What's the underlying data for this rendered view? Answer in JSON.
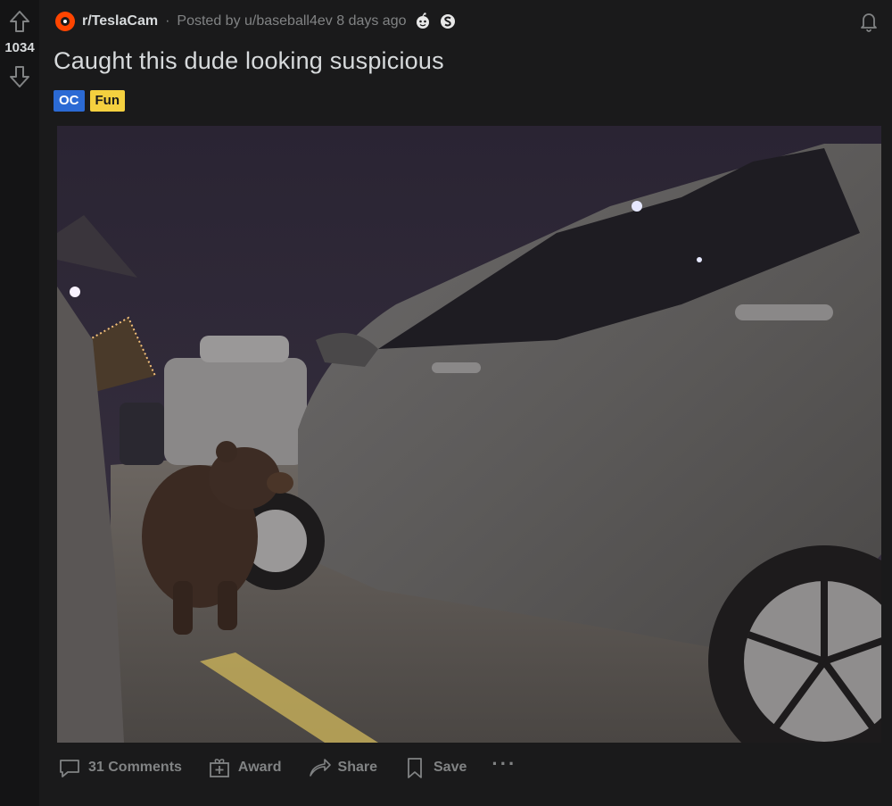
{
  "vote": {
    "score": "1034"
  },
  "post": {
    "subreddit": "r/TeslaCam",
    "separator": "·",
    "posted_by_prefix": "Posted by",
    "author": "u/baseball4ev",
    "age": "8 days ago",
    "title": "Caught this dude looking suspicious",
    "flairs": [
      {
        "label": "OC",
        "color": "#2b6ad4"
      },
      {
        "label": "Fun",
        "color": "#f4d03f"
      }
    ]
  },
  "media": {
    "icon": "video-thumbnail"
  },
  "actions": {
    "comments": "31 Comments",
    "award": "Award",
    "share": "Share",
    "save": "Save",
    "more": "···"
  },
  "colors": {
    "background": "#1a1a1b",
    "subreddit_icon": "#ff4500",
    "text": "#d7dadc",
    "muted": "#818384"
  }
}
